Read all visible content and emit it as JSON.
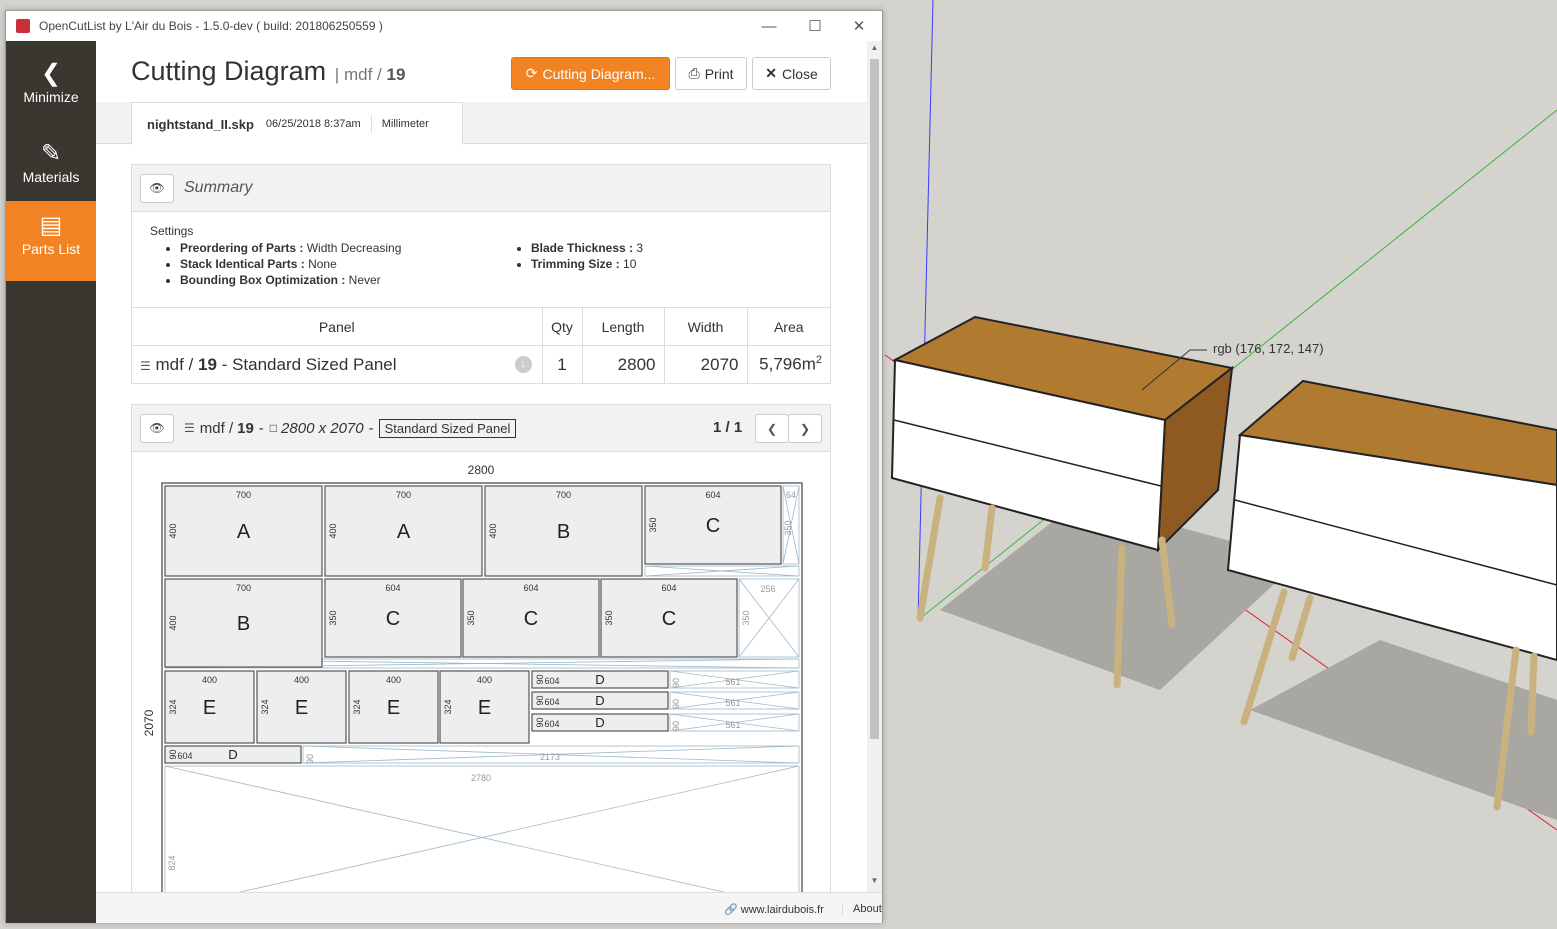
{
  "window": {
    "title": "OpenCutList by L'Air du Bois - 1.5.0-dev ( build: 201806250559 )",
    "controls": {
      "minimize": "—",
      "maximize": "☐",
      "close": "✕"
    }
  },
  "sidebar": {
    "items": [
      {
        "label": "Minimize",
        "icon": "chevron-left-icon"
      },
      {
        "label": "Materials",
        "icon": "paint-icon"
      },
      {
        "label": "Parts List",
        "icon": "list-icon"
      }
    ]
  },
  "header": {
    "title": "Cutting Diagram",
    "material": "mdf /",
    "thickness": "19",
    "buttons": {
      "cutting": "Cutting Diagram...",
      "print": "Print",
      "close": "Close"
    }
  },
  "file_tab": {
    "filename": "nightstand_II.skp",
    "date": "06/25/2018 8:37am",
    "unit": "Millimeter"
  },
  "summary": {
    "title": "Summary",
    "settings_label": "Settings",
    "left": [
      {
        "k": "Preordering of Parts :",
        "v": "Width Decreasing"
      },
      {
        "k": "Stack Identical Parts :",
        "v": "None"
      },
      {
        "k": "Bounding Box Optimization :",
        "v": "Never"
      }
    ],
    "right": [
      {
        "k": "Blade Thickness :",
        "v": "3"
      },
      {
        "k": "Trimming Size :",
        "v": "10"
      }
    ],
    "table": {
      "headers": [
        "Panel",
        "Qty",
        "Length",
        "Width",
        "Area"
      ],
      "row": {
        "material": "mdf /",
        "thickness": "19",
        "name": "- Standard Sized Panel",
        "qty": "1",
        "length": "2800",
        "width": "2070",
        "area": "5,796m",
        "area_sup": "2"
      }
    }
  },
  "sheet": {
    "material": "mdf /",
    "thickness": "19",
    "size": "2800 x 2070",
    "dash": "-",
    "tag": "Standard Sized Panel",
    "page": "1 / 1",
    "length_label": "2800",
    "width_label": "2070",
    "parts": [
      {
        "l": "A",
        "w": "700",
        "h": "400"
      },
      {
        "l": "A",
        "w": "700",
        "h": "400"
      },
      {
        "l": "B",
        "w": "700",
        "h": "400"
      },
      {
        "l": "C",
        "w": "604",
        "h": "350"
      },
      {
        "l": "B",
        "w": "700",
        "h": "400"
      },
      {
        "l": "C",
        "w": "604",
        "h": "350"
      },
      {
        "l": "C",
        "w": "604",
        "h": "350"
      },
      {
        "l": "C",
        "w": "604",
        "h": "350"
      },
      {
        "l": "E",
        "w": "400",
        "h": "324"
      },
      {
        "l": "E",
        "w": "400",
        "h": "324"
      },
      {
        "l": "E",
        "w": "400",
        "h": "324"
      },
      {
        "l": "E",
        "w": "400",
        "h": "324"
      },
      {
        "l": "D",
        "w": "604",
        "h": "90"
      },
      {
        "l": "D",
        "w": "604",
        "h": "90"
      },
      {
        "l": "D",
        "w": "604",
        "h": "90"
      },
      {
        "l": "D",
        "w": "604",
        "h": "90"
      }
    ],
    "waste_labels": [
      "64",
      "350",
      "256",
      "350",
      "561",
      "90",
      "561",
      "90",
      "561",
      "90",
      "90",
      "2173",
      "2780",
      "824"
    ]
  },
  "footer": {
    "link": "www.lairdubois.fr",
    "about": "About"
  },
  "model_label": "rgb (176, 172, 147)"
}
